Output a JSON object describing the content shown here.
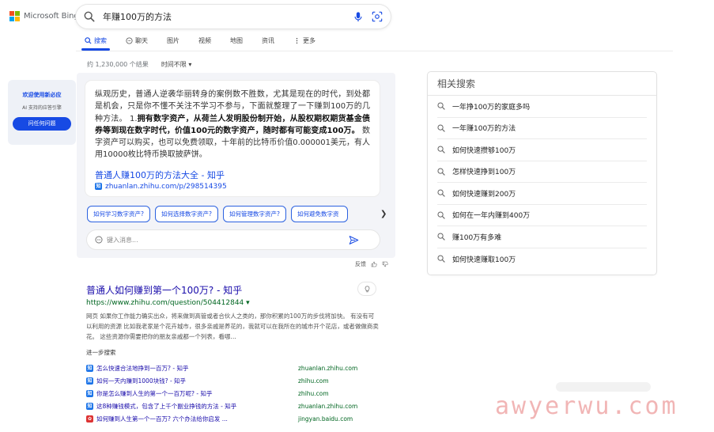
{
  "brand": {
    "name": "Microsoft Bing",
    "colors": [
      "#f25022",
      "#7fba00",
      "#00a4ef",
      "#ffb900"
    ]
  },
  "search": {
    "query": "年赚100万的方法"
  },
  "tabs": [
    {
      "label": "搜索",
      "icon": "search-icon",
      "active": true
    },
    {
      "label": "聊天",
      "icon": "chat-icon",
      "active": false
    },
    {
      "label": "图片",
      "icon": "",
      "active": false
    },
    {
      "label": "视频",
      "icon": "",
      "active": false
    },
    {
      "label": "地图",
      "icon": "",
      "active": false
    },
    {
      "label": "资讯",
      "icon": "",
      "active": false
    },
    {
      "label": "更多",
      "icon": "more-icon",
      "active": false
    }
  ],
  "filters": {
    "result_count": "约 1,230,000 个结果",
    "time": "时间不限 ▾"
  },
  "sidebar": {
    "title": "欢迎使用新必应",
    "subtitle": "AI 支持的应答引擎",
    "button": "问任何问题"
  },
  "answer": {
    "text_1": "纵观历史，普通人逆袭华丽转身的案例数不胜数，尤其是现在的时代，到处都是机会，只是你不懂不关注不学习不参与，下面就整理了一下赚到100万的几种方法。 1.",
    "text_bold": "拥有数字资产，从荷兰人发明股份制开始，从股权期权期货基金债券等到现在数字时代，价值100元的数字资产，随时都有可能变成100万。",
    "text_2": "数字资产可以购买，也可以免费领取，十年前的比特币价值0.000001美元，有人用10000枚比特币换取披萨饼。",
    "link_title": "普通人赚100万的方法大全 - 知乎",
    "link_url": "zhuanlan.zhihu.com/p/298514395",
    "favicon": "知"
  },
  "suggestions": [
    "如何学习数字资产?",
    "如何选择数字资产?",
    "如何管理数字资产?",
    "如何避免数字资"
  ],
  "message_box": {
    "placeholder": "键入消息..."
  },
  "feedback": {
    "label": "反馈"
  },
  "result": {
    "title": "普通人如何赚到第一个100万? - 知乎",
    "url": "https://www.zhihu.com/question/504412844 ▾",
    "snippet": "网页 如果你工作能力确实出众，将来做到高管或者合伙人之类的，那你积累的100万的步伐将加快。 有没有可以利用的资源 比如我老家是个花卉城市，很多亲戚是养花的，我就可以在我所在的城市开个花店，或者做做商卖花。 这些资源你需要把你的朋友亲戚都一个列表，看哪…"
  },
  "further": {
    "label": "进一步搜索",
    "items": [
      {
        "text": "怎么快速合法地挣到一百万? - 知乎",
        "domain": "zhuanlan.zhihu.com"
      },
      {
        "text": "如何一天内赚到1000块钱? - 知乎",
        "domain": "zhihu.com"
      },
      {
        "text": "你是怎么赚到人生的第一个一百万呢? - 知乎",
        "domain": "zhihu.com"
      },
      {
        "text": "这8种赚钱模式，包含了上千个副业挣钱的方法 - 知乎",
        "domain": "zhuanlan.zhihu.com"
      },
      {
        "text": "如何赚到人生第一个一百万? 六个办法给你启发 ...",
        "domain": "jingyan.baidu.com"
      }
    ]
  },
  "related": {
    "title": "相关搜索",
    "items": [
      "一年挣100万的家庭多吗",
      "一年赚100万的方法",
      "如何快速攒够100万",
      "怎样快速挣到100万",
      "如何快速赚到200万",
      "如何在一年内赚到400万",
      "赚100万有多难",
      "如何快速赚取100万"
    ]
  },
  "watermark": "awyerwu.com"
}
